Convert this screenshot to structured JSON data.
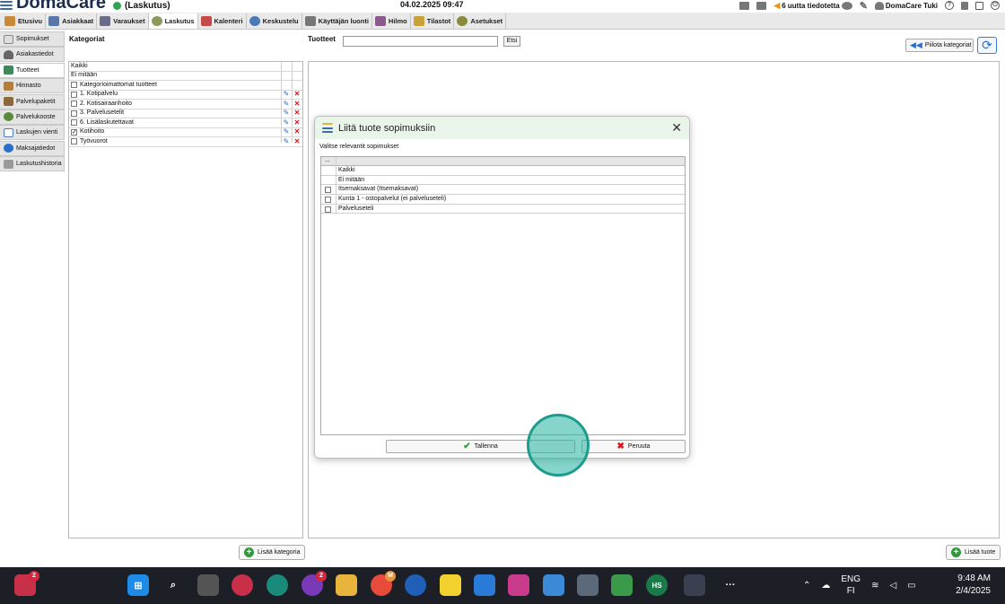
{
  "app": {
    "name": "DomaCare",
    "module": "(Laskutus)",
    "datetime": "04.02.2025 09:47"
  },
  "topright": {
    "notifications": "6 uutta tiedotetta",
    "user": "DomaCare Tuki",
    "help": "?"
  },
  "menu": [
    "Etusivu",
    "Asiakkaat",
    "Varaukset",
    "Laskutus",
    "Kalenteri",
    "Keskustelu",
    "Käyttäjän luonti",
    "Hilmo",
    "Tilastot",
    "Asetukset"
  ],
  "sidebar": [
    "Sopimukset",
    "Asiakastiedot",
    "Tuotteet",
    "Hinnasto",
    "Palvelupaketit",
    "Palvelukooste",
    "Laskujen vienti",
    "Maksajatiedot",
    "Laskutushistoria"
  ],
  "categories": {
    "title": "Kategoriat",
    "rows": [
      "Kaikki",
      "Ei mitään",
      "Kategorioimattomat tuotteet",
      "1. Kotipalvelu",
      "2. Kotisairaanhoito",
      "3. Palvelusetelit",
      "6. Lisälaskutettavat",
      "Kotihoito",
      "Työvuorot"
    ],
    "add_button": "Lisää kategoria"
  },
  "products": {
    "title": "Tuotteet",
    "search_button": "Etsi",
    "hide_button": "Piilota kategoriat",
    "add_button": "Lisää tuote"
  },
  "dialog": {
    "title": "Liitä tuote sopimuksiin",
    "subtitle": "Valitse relevantit sopimukset",
    "grid_header": "...",
    "rows": [
      "Kaikki",
      "Ei mitään",
      "Itsemaksavat  (Itsemaksavat)",
      "Kunta 1 - ostopalvelut (ei palveluseteli)",
      "Palveluseteli"
    ],
    "save": "Tallenna",
    "cancel": "Peruuta",
    "close": "✕"
  },
  "taskbar": {
    "lang_top": "ENG",
    "lang_bottom": "FI",
    "time": "9:48 AM",
    "date": "2/4/2025",
    "badge_1": "2",
    "badge_2": "2",
    "badge_3": "M",
    "hs_label": "HS",
    "more": "···"
  },
  "colors": {
    "accent_green": "#2f9a3a",
    "delete_red": "#d4161a",
    "pen_blue": "#2b6cc7",
    "cursor_teal": "#20b2a0"
  }
}
